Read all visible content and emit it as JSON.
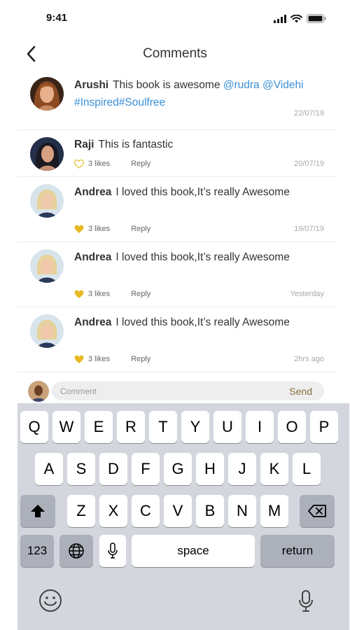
{
  "status_bar": {
    "time": "9:41"
  },
  "header": {
    "title": "Comments"
  },
  "comments": [
    {
      "author": "Arushi",
      "text": "This book is awesome ",
      "mentions": "@rudra @Videhi #Inspired#Soulfree",
      "time": "22/07/19"
    },
    {
      "author": "Raji",
      "text": "This is fantastic",
      "likes": "3 likes",
      "reply": "Reply",
      "time": "20/07/19",
      "liked": false
    },
    {
      "author": "Andrea",
      "text": "I loved this book,It’s really Awesome",
      "likes": "3 likes",
      "reply": "Reply",
      "time": "19/07/19",
      "liked": true
    },
    {
      "author": "Andrea",
      "text": "I loved this book,It’s really Awesome",
      "likes": "3 likes",
      "reply": "Reply",
      "time": "Yesterday",
      "liked": true
    },
    {
      "author": "Andrea",
      "text": "I loved this book,It’s really Awesome",
      "likes": "3 likes",
      "reply": "Reply",
      "time": "2hrs ago",
      "liked": true
    }
  ],
  "comment_input": {
    "placeholder": "Comment",
    "value": "",
    "send_label": "Send"
  },
  "keyboard": {
    "row1": [
      "Q",
      "W",
      "E",
      "R",
      "T",
      "Y",
      "U",
      "I",
      "O",
      "P"
    ],
    "row2": [
      "A",
      "S",
      "D",
      "F",
      "G",
      "H",
      "J",
      "K",
      "L"
    ],
    "row3": [
      "Z",
      "X",
      "C",
      "V",
      "B",
      "N",
      "M"
    ],
    "numbers_label": "123",
    "space_label": "space",
    "return_label": "return"
  },
  "colors": {
    "mention": "#3a8fd6",
    "heart_filled": "#e8b923",
    "send": "#8a6d3b",
    "keyboard_bg": "#d3d6dd"
  },
  "icons": [
    "back-chevron-icon",
    "signal-icon",
    "wifi-icon",
    "battery-icon",
    "heart-icon",
    "shift-icon",
    "backspace-icon",
    "globe-icon",
    "mic-icon",
    "emoji-icon"
  ]
}
